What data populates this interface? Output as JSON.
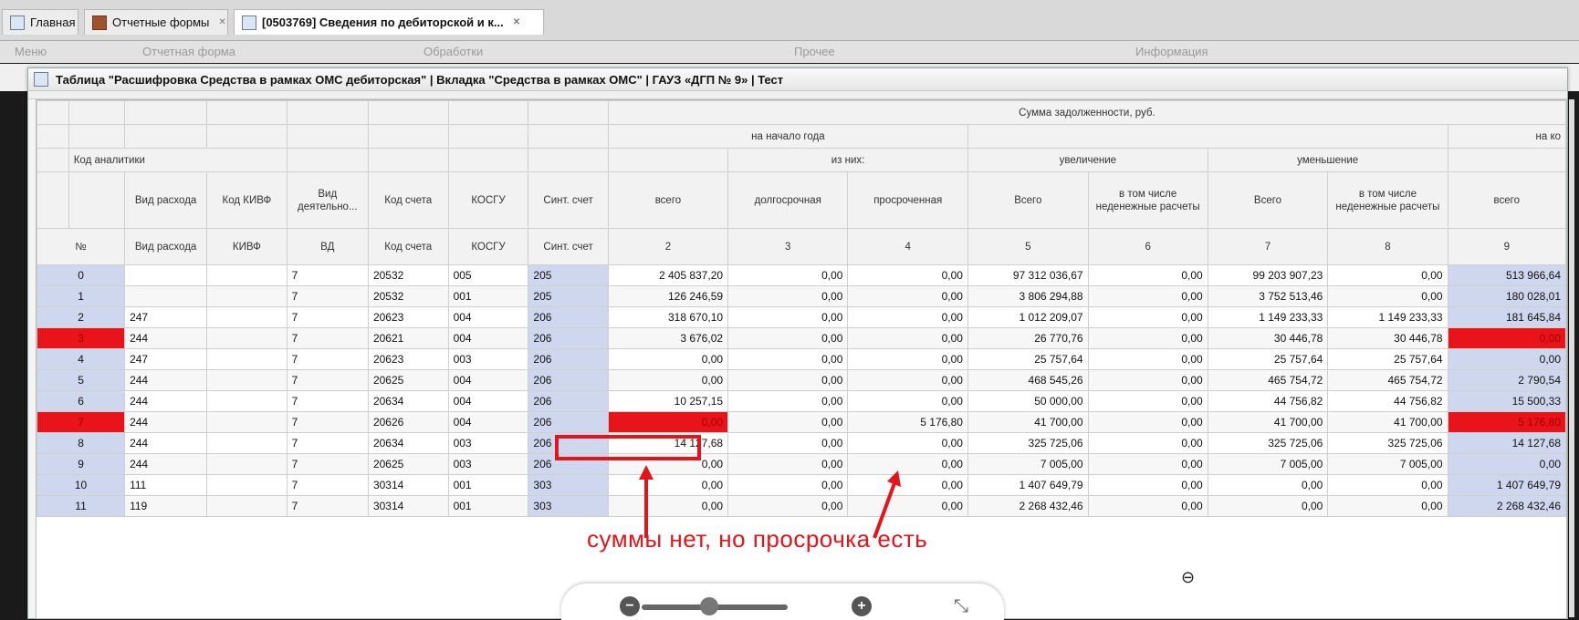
{
  "tabs": [
    {
      "label": "Главная",
      "closable": false
    },
    {
      "label": "Отчетные формы",
      "closable": true
    },
    {
      "label": "[0503769] Сведения по дебиторской и к...",
      "closable": true
    }
  ],
  "menu": [
    "Меню",
    "Отчетная форма",
    "Обработки",
    "Прочее",
    "Информация"
  ],
  "window": {
    "title": "Таблица \"Расшифровка Средства в рамках ОМС дебиторская\" | Вкладка \"Средства в рамках ОМС\" | ГАУЗ «ДГП № 9» | Тест"
  },
  "headers": {
    "sum_debt": "Сумма задолженности, руб.",
    "start_year": "на начало года",
    "of_them": "из них:",
    "increase": "увеличение",
    "decrease": "уменьшение",
    "start_year_2": "на ко",
    "analytics_code": "Код аналитики",
    "cols": [
      "Вид расхода",
      "Код КИВФ",
      "Вид деятельно...",
      "Код счета",
      "КОСГУ",
      "Синт. счет",
      "всего",
      "долгосрочная",
      "просроченная",
      "Всего",
      "в том числе неденежные расчеты",
      "Всего",
      "в том числе неденежные расчеты",
      "всего"
    ],
    "codes": [
      "№",
      "Вид расхода",
      "КИВФ",
      "ВД",
      "Код счета",
      "КОСГУ",
      "Синт. счет",
      "2",
      "3",
      "4",
      "5",
      "6",
      "7",
      "8",
      "9"
    ]
  },
  "rows": [
    [
      "0",
      "",
      "",
      "7",
      "20532",
      "005",
      "205",
      "2 405 837,20",
      "0,00",
      "0,00",
      "97 312 036,67",
      "0,00",
      "99 203 907,23",
      "0,00",
      "513 966,64"
    ],
    [
      "1",
      "",
      "",
      "7",
      "20532",
      "001",
      "205",
      "126 246,59",
      "0,00",
      "0,00",
      "3 806 294,88",
      "0,00",
      "3 752 513,46",
      "0,00",
      "180 028,01"
    ],
    [
      "2",
      "247",
      "",
      "7",
      "20623",
      "004",
      "206",
      "318 670,10",
      "0,00",
      "0,00",
      "1 012 209,07",
      "0,00",
      "1 149 233,33",
      "1 149 233,33",
      "181 645,84"
    ],
    [
      "3",
      "244",
      "",
      "7",
      "20621",
      "004",
      "206",
      "3 676,02",
      "0,00",
      "0,00",
      "26 770,76",
      "0,00",
      "30 446,78",
      "30 446,78",
      "0,00"
    ],
    [
      "4",
      "247",
      "",
      "7",
      "20623",
      "003",
      "206",
      "0,00",
      "0,00",
      "0,00",
      "25 757,64",
      "0,00",
      "25 757,64",
      "25 757,64",
      "0,00"
    ],
    [
      "5",
      "244",
      "",
      "7",
      "20625",
      "004",
      "206",
      "0,00",
      "0,00",
      "0,00",
      "468 545,26",
      "0,00",
      "465 754,72",
      "465 754,72",
      "2 790,54"
    ],
    [
      "6",
      "244",
      "",
      "7",
      "20634",
      "004",
      "206",
      "10 257,15",
      "0,00",
      "0,00",
      "50 000,00",
      "0,00",
      "44 756,82",
      "44 756,82",
      "15 500,33"
    ],
    [
      "7",
      "244",
      "",
      "7",
      "20626",
      "004",
      "206",
      "0,00",
      "0,00",
      "5 176,80",
      "41 700,00",
      "0,00",
      "41 700,00",
      "41 700,00",
      "5 176,80"
    ],
    [
      "8",
      "244",
      "",
      "7",
      "20634",
      "003",
      "206",
      "14 127,68",
      "0,00",
      "0,00",
      "325 725,06",
      "0,00",
      "325 725,06",
      "325 725,06",
      "14 127,68"
    ],
    [
      "9",
      "244",
      "",
      "7",
      "20625",
      "003",
      "206",
      "0,00",
      "0,00",
      "0,00",
      "7 005,00",
      "0,00",
      "7 005,00",
      "7 005,00",
      "0,00"
    ],
    [
      "10",
      "111",
      "",
      "7",
      "30314",
      "001",
      "303",
      "0,00",
      "0,00",
      "0,00",
      "1 407 649,79",
      "0,00",
      "0,00",
      "0,00",
      "1 407 649,79"
    ],
    [
      "11",
      "119",
      "",
      "7",
      "30314",
      "001",
      "303",
      "0,00",
      "0,00",
      "0,00",
      "2 268 432,46",
      "0,00",
      "0,00",
      "0,00",
      "2 268 432,46"
    ]
  ],
  "highlight_rows": [
    "3",
    "7"
  ],
  "annotation": {
    "text": "суммы нет, но просрочка есть",
    "color": "#e4141b"
  },
  "zoom": {
    "minus": "−",
    "plus": "+"
  }
}
